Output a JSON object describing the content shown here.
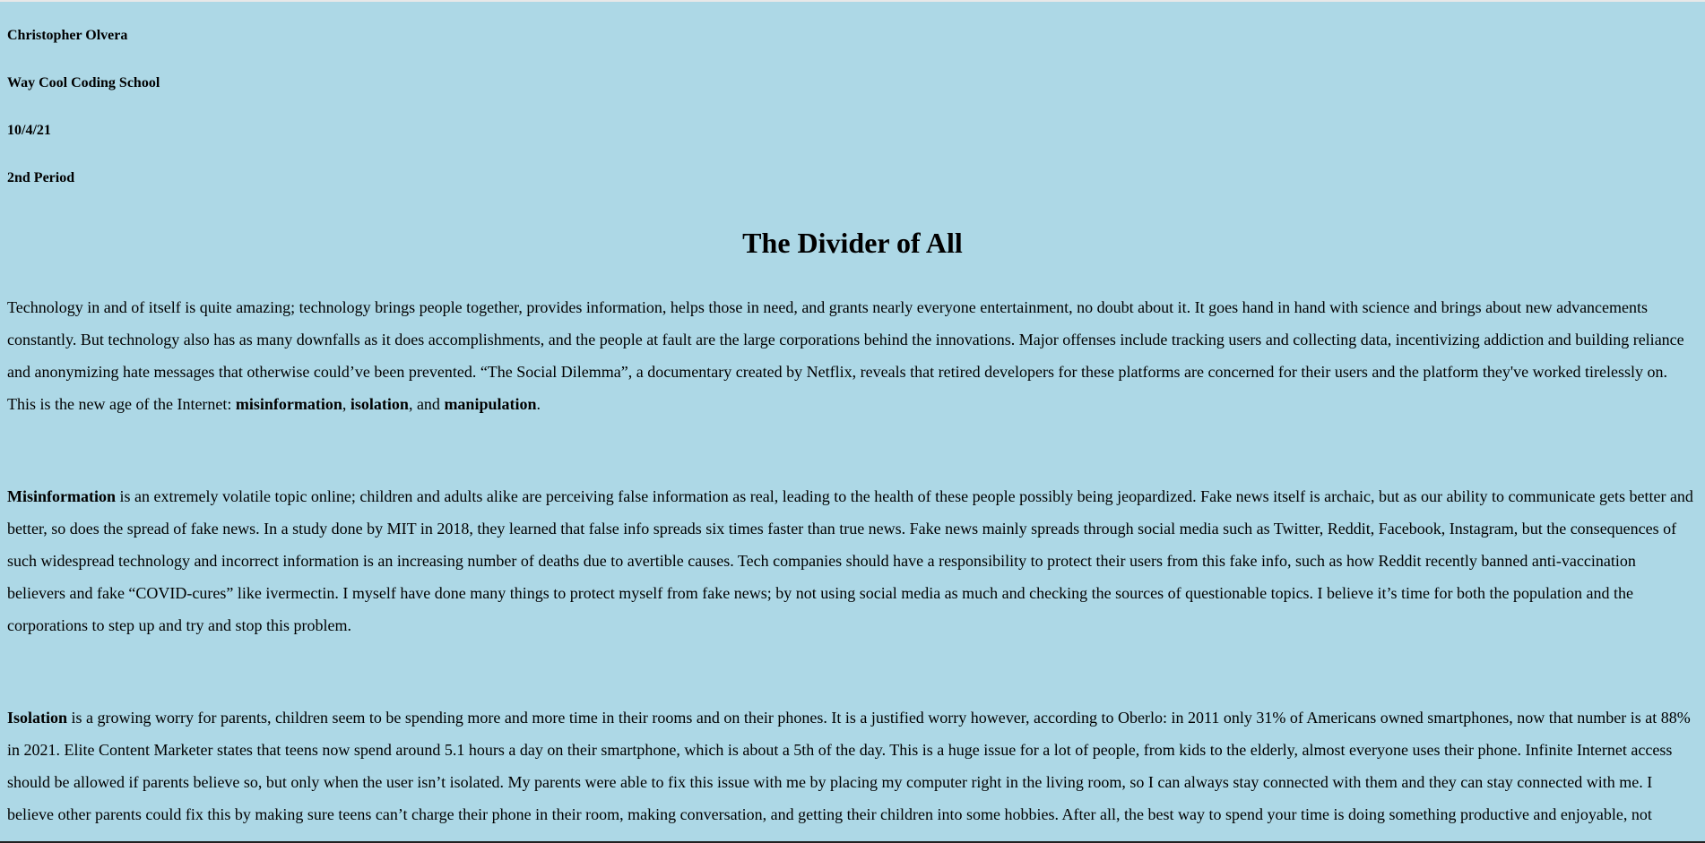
{
  "header": {
    "author": "Christopher Olvera",
    "school": "Way Cool Coding School",
    "date": "10/4/21",
    "period": "2nd Period"
  },
  "title": "The Divider of All",
  "intro": {
    "text_before": "Technology in and of itself is quite amazing; technology brings people together, provides information, helps those in need, and grants nearly everyone entertainment, no doubt about it. It goes hand in hand with science and brings about new advancements constantly. But technology also has as many downfalls as it does accomplishments, and the people at fault are the large corporations behind the innovations. Major offenses include tracking users and collecting data, incentivizing addiction and building reliance and anonymizing hate messages that otherwise could’ve been prevented. “The Social Dilemma”, a documentary created by Netflix, reveals that retired developers for these platforms are concerned for their users and the platform they've worked tirelessly on. This is the new age of the Internet: ",
    "term1": "misinformation",
    "sep1": ", ",
    "term2": "isolation",
    "sep2": ", and ",
    "term3": "manipulation",
    "end": "."
  },
  "misinformation": {
    "term": "Misinformation",
    "text": " is an extremely volatile topic online; children and adults alike are perceiving false information as real, leading to the health of these people possibly being jeopardized. Fake news itself is archaic, but as our ability to communicate gets better and better, so does the spread of fake news. In a study done by MIT in 2018, they learned that false info spreads six times faster than true news. Fake news mainly spreads through social media such as Twitter, Reddit, Facebook, Instagram, but the consequences of such widespread technology and incorrect information is an increasing number of deaths due to avertible causes. Tech companies should have a responsibility to protect their users from this fake info, such as how Reddit recently banned anti-vaccination believers and fake “COVID-cures” like ivermectin. I myself have done many things to protect myself from fake news; by not using social media as much and checking the sources of questionable topics. I believe it’s time for both the population and the corporations to step up and try and stop this problem."
  },
  "isolation": {
    "term": "Isolation",
    "text": " is a growing worry for parents, children seem to be spending more and more time in their rooms and on their phones. It is a justified worry however, according to Oberlo: in 2011 only 31% of Americans owned smartphones, now that number is at 88% in 2021. Elite Content Marketer states that teens now spend around 5.1 hours a day on their smartphone, which is about a 5th of the day. This is a huge issue for a lot of people, from kids to the elderly, almost everyone uses their phone. Infinite Internet access should be allowed if parents believe so, but only when the user isn’t isolated. My parents were able to fix this issue with me by placing my computer right in the living room, so I can always stay connected with them and they can stay connected with me. I believe other parents could fix this by making sure teens can’t charge their phone in their room, making conversation, and getting their children into some hobbies. After all, the best way to spend your time is doing something productive and enjoyable, not"
  }
}
